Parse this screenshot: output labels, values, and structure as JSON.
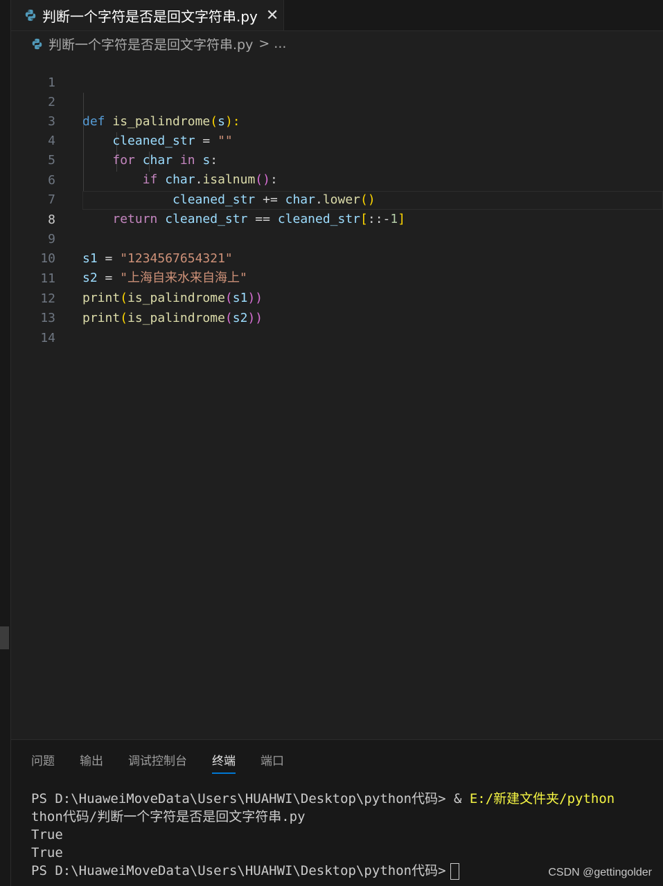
{
  "tab": {
    "filename": "判断一个字符是否是回文字符串.py",
    "close": "✕"
  },
  "breadcrumb": {
    "filename": "判断一个字符是否是回文字符串.py",
    "separator": ">",
    "rest": "..."
  },
  "editor": {
    "active_line": 8,
    "line_numbers": [
      "1",
      "2",
      "3",
      "4",
      "5",
      "6",
      "7",
      "8",
      "9",
      "10",
      "11",
      "12",
      "13",
      "14"
    ],
    "code": {
      "l2": [
        "def",
        "is_palindrome",
        "(",
        "s",
        "):"
      ],
      "l3": [
        "cleaned_str",
        " = ",
        "\"\""
      ],
      "l4": [
        "for",
        "char",
        "in",
        "s",
        ":"
      ],
      "l5": [
        "if",
        "char",
        ".",
        "isalnum",
        "()",
        ":"
      ],
      "l6": [
        "cleaned_str",
        " += ",
        "char",
        ".",
        "lower",
        "()"
      ],
      "l7": [
        "return",
        "cleaned_str",
        " == ",
        "cleaned_str",
        "[",
        "::-",
        "1",
        "]"
      ],
      "l9": [
        "s1",
        " = ",
        "\"1234567654321\""
      ],
      "l10": [
        "s2",
        " = ",
        "\"上海自来水来自海上\""
      ],
      "l11": [
        "print",
        "(",
        "is_palindrome",
        "(",
        "s1",
        "))"
      ],
      "l12": [
        "print",
        "(",
        "is_palindrome",
        "(",
        "s2",
        "))"
      ]
    }
  },
  "panel": {
    "tabs": [
      "问题",
      "输出",
      "调试控制台",
      "终端",
      "端口"
    ],
    "active_tab": "终端"
  },
  "terminal": {
    "line1_prompt": "PS D:\\HuaweiMoveData\\Users\\HUAHWI\\Desktop\\python代码> ",
    "line1_amp": "& ",
    "line1_path": "E:/新建文件夹/python",
    "line2": "thon代码/判断一个字符是否是回文字符串.py",
    "line3": "True",
    "line4": "True",
    "line5_prompt": "PS D:\\HuaweiMoveData\\Users\\HUAHWI\\Desktop\\python代码>"
  },
  "watermark": "CSDN @gettingolder",
  "colors": {
    "keyword": "#569cd6",
    "control": "#c586c0",
    "function": "#dcdcaa",
    "variable": "#9cdcfe",
    "string": "#ce9178",
    "number": "#b5cea8",
    "accent": "#0078d4"
  }
}
